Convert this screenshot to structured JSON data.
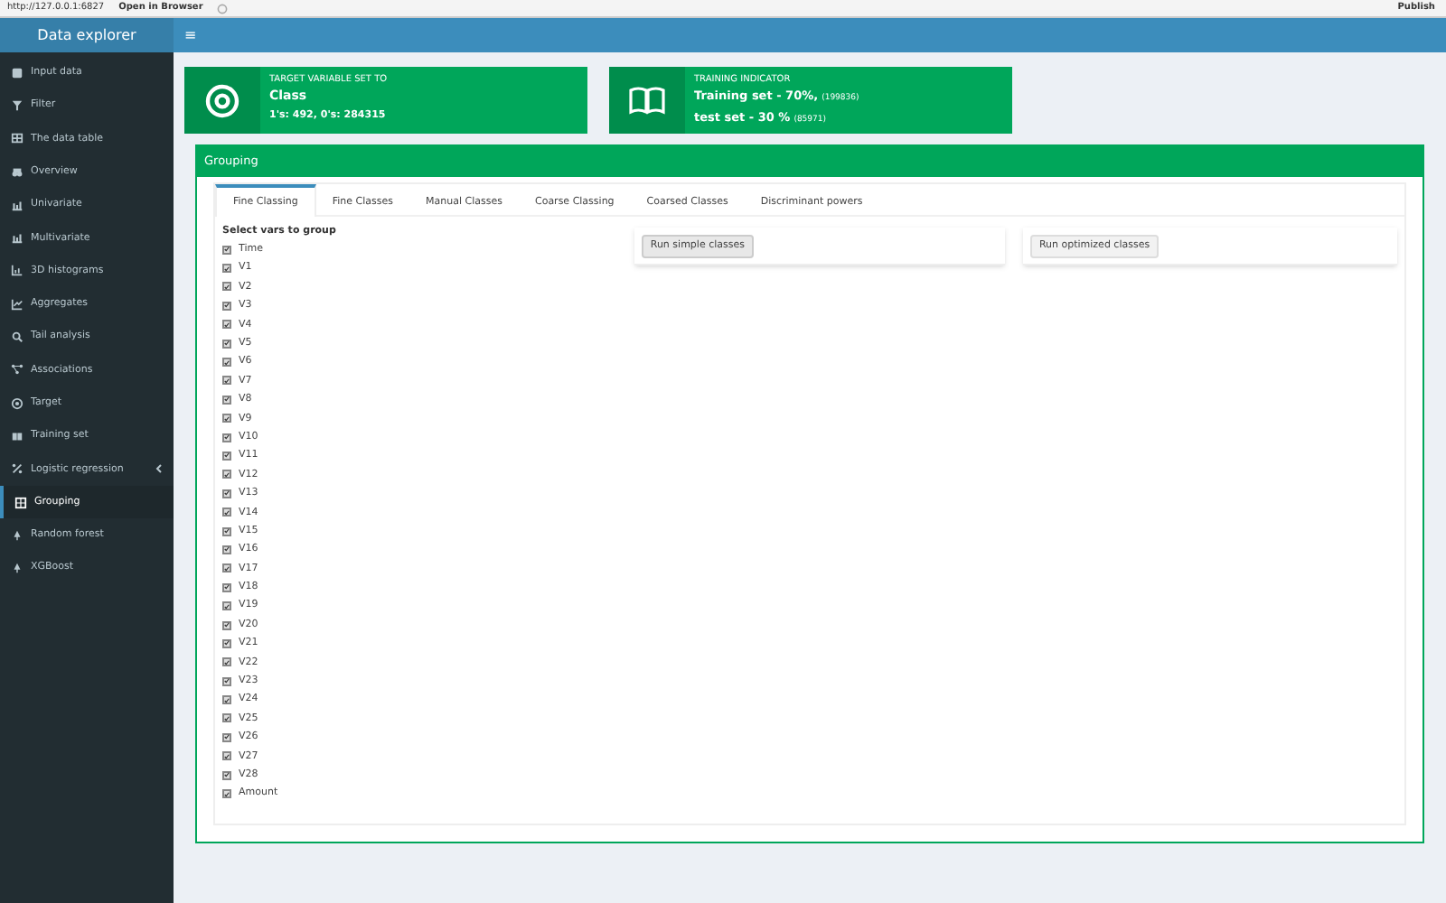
{
  "browser_bar": {
    "url": "http://127.0.0.1:6827",
    "open_button": "Open in Browser",
    "publish_button": "Publish"
  },
  "header": {
    "title": "Data explorer",
    "menu_toggle": "≡"
  },
  "sidebar": {
    "items": [
      {
        "label": "Input data",
        "selected": false
      },
      {
        "label": "Filter",
        "selected": false
      },
      {
        "label": "The data table",
        "selected": false
      },
      {
        "label": "Overview",
        "selected": false
      },
      {
        "label": "Univariate",
        "selected": false
      },
      {
        "label": "Multivariate",
        "selected": false
      },
      {
        "label": "3D histograms",
        "selected": false
      },
      {
        "label": "Aggregates",
        "selected": false
      },
      {
        "label": "Tail analysis",
        "selected": false
      },
      {
        "label": "Associations",
        "selected": false
      },
      {
        "label": "Target",
        "selected": false
      },
      {
        "label": "Training set",
        "selected": false
      },
      {
        "label": "Logistic regression",
        "selected": false,
        "expandable": true
      },
      {
        "label": "Grouping",
        "selected": true
      },
      {
        "label": "Random forest",
        "selected": false
      },
      {
        "label": "XGBoost",
        "selected": false
      }
    ]
  },
  "info_boxes": [
    {
      "kind": "target",
      "caption": "TARGET VARIABLE SET TO",
      "value": "Class",
      "detail": "1's: 492, 0's: 284315"
    },
    {
      "kind": "book",
      "caption": "TRAINING INDICATOR",
      "lines": [
        {
          "main": "Training set - 70%,",
          "note": "(199836)"
        },
        {
          "main": "test set - 30 %",
          "note": "(85971)"
        }
      ]
    }
  ],
  "grouping": {
    "title": "Grouping",
    "tabs": [
      {
        "label": "Fine Classing",
        "selected": true
      },
      {
        "label": "Fine Classes",
        "selected": false
      },
      {
        "label": "Manual Classes",
        "selected": false
      },
      {
        "label": "Coarse Classing",
        "selected": false
      },
      {
        "label": "Coarsed Classes",
        "selected": false
      },
      {
        "label": "Discriminant powers",
        "selected": false
      }
    ],
    "vars_label": "Select vars to group",
    "vars": [
      {
        "label": "Time",
        "checked": true
      },
      {
        "label": "V1",
        "checked": true
      },
      {
        "label": "V2",
        "checked": true
      },
      {
        "label": "V3",
        "checked": true
      },
      {
        "label": "V4",
        "checked": true
      },
      {
        "label": "V5",
        "checked": true
      },
      {
        "label": "V6",
        "checked": true
      },
      {
        "label": "V7",
        "checked": true
      },
      {
        "label": "V8",
        "checked": true
      },
      {
        "label": "V9",
        "checked": true
      },
      {
        "label": "V10",
        "checked": true
      },
      {
        "label": "V11",
        "checked": true
      },
      {
        "label": "V12",
        "checked": true
      },
      {
        "label": "V13",
        "checked": true
      },
      {
        "label": "V14",
        "checked": true
      },
      {
        "label": "V15",
        "checked": true
      },
      {
        "label": "V16",
        "checked": true
      },
      {
        "label": "V17",
        "checked": true
      },
      {
        "label": "V18",
        "checked": true
      },
      {
        "label": "V19",
        "checked": true
      },
      {
        "label": "V20",
        "checked": true
      },
      {
        "label": "V21",
        "checked": true
      },
      {
        "label": "V22",
        "checked": true
      },
      {
        "label": "V23",
        "checked": true
      },
      {
        "label": "V24",
        "checked": true
      },
      {
        "label": "V25",
        "checked": true
      },
      {
        "label": "V26",
        "checked": true
      },
      {
        "label": "V27",
        "checked": true
      },
      {
        "label": "V28",
        "checked": true
      },
      {
        "label": "Amount",
        "checked": true
      }
    ],
    "buttons": [
      "Run simple classes",
      "Run optimized classes"
    ]
  }
}
